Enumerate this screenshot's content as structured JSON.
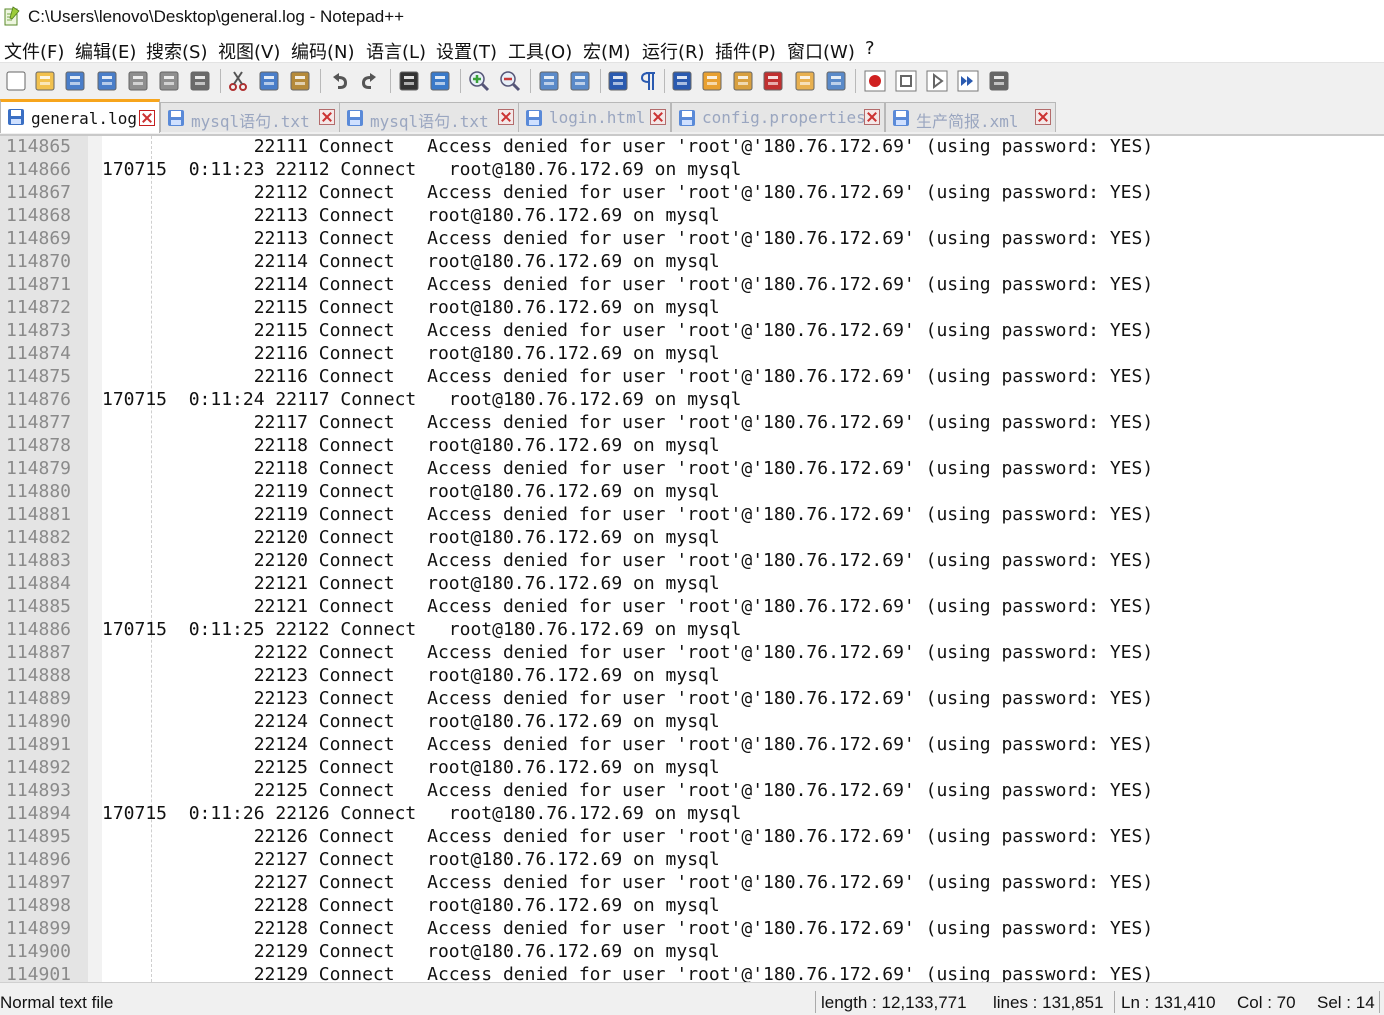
{
  "window": {
    "title": "C:\\Users\\lenovo\\Desktop\\general.log - Notepad++"
  },
  "menu": [
    "文件(F)",
    "编辑(E)",
    "搜索(S)",
    "视图(V)",
    "编码(N)",
    "语言(L)",
    "设置(T)",
    "工具(O)",
    "宏(M)",
    "运行(R)",
    "插件(P)",
    "窗口(W)",
    "?"
  ],
  "toolbar": {
    "icons": [
      "new-file-icon",
      "open-file-icon",
      "save-icon",
      "save-all-icon",
      "close-icon",
      "close-all-icon",
      "print-icon",
      "cut-icon",
      "copy-icon",
      "paste-icon",
      "undo-icon",
      "redo-icon",
      "find-icon",
      "replace-icon",
      "zoom-in-icon",
      "zoom-out-icon",
      "sync-vertical-icon",
      "sync-horizontal-icon",
      "word-wrap-icon",
      "show-all-chars-icon",
      "indent-guide-icon",
      "language-icon",
      "doc-map-icon",
      "function-list-icon",
      "folder-workspace-icon",
      "monitoring-icon",
      "record-macro-icon",
      "stop-record-icon",
      "play-macro-icon",
      "run-macro-multiple-icon",
      "save-macro-icon"
    ]
  },
  "tabs": [
    {
      "label": "general.log",
      "active": true
    },
    {
      "label": "mysql语句.txt",
      "active": false
    },
    {
      "label": "mysql语句.txt",
      "active": false
    },
    {
      "label": "login.html",
      "active": false
    },
    {
      "label": "config.properties",
      "active": false
    },
    {
      "label": "生产简报.xml",
      "active": false
    }
  ],
  "editor": {
    "lines": [
      {
        "num": "114865",
        "text": "              22111 Connect   Access denied for user 'root'@'180.76.172.69' (using password: YES)"
      },
      {
        "num": "114866",
        "text": "170715  0:11:23 22112 Connect   root@180.76.172.69 on mysql"
      },
      {
        "num": "114867",
        "text": "              22112 Connect   Access denied for user 'root'@'180.76.172.69' (using password: YES)"
      },
      {
        "num": "114868",
        "text": "              22113 Connect   root@180.76.172.69 on mysql"
      },
      {
        "num": "114869",
        "text": "              22113 Connect   Access denied for user 'root'@'180.76.172.69' (using password: YES)"
      },
      {
        "num": "114870",
        "text": "              22114 Connect   root@180.76.172.69 on mysql"
      },
      {
        "num": "114871",
        "text": "              22114 Connect   Access denied for user 'root'@'180.76.172.69' (using password: YES)"
      },
      {
        "num": "114872",
        "text": "              22115 Connect   root@180.76.172.69 on mysql"
      },
      {
        "num": "114873",
        "text": "              22115 Connect   Access denied for user 'root'@'180.76.172.69' (using password: YES)"
      },
      {
        "num": "114874",
        "text": "              22116 Connect   root@180.76.172.69 on mysql"
      },
      {
        "num": "114875",
        "text": "              22116 Connect   Access denied for user 'root'@'180.76.172.69' (using password: YES)"
      },
      {
        "num": "114876",
        "text": "170715  0:11:24 22117 Connect   root@180.76.172.69 on mysql"
      },
      {
        "num": "114877",
        "text": "              22117 Connect   Access denied for user 'root'@'180.76.172.69' (using password: YES)"
      },
      {
        "num": "114878",
        "text": "              22118 Connect   root@180.76.172.69 on mysql"
      },
      {
        "num": "114879",
        "text": "              22118 Connect   Access denied for user 'root'@'180.76.172.69' (using password: YES)"
      },
      {
        "num": "114880",
        "text": "              22119 Connect   root@180.76.172.69 on mysql"
      },
      {
        "num": "114881",
        "text": "              22119 Connect   Access denied for user 'root'@'180.76.172.69' (using password: YES)"
      },
      {
        "num": "114882",
        "text": "              22120 Connect   root@180.76.172.69 on mysql"
      },
      {
        "num": "114883",
        "text": "              22120 Connect   Access denied for user 'root'@'180.76.172.69' (using password: YES)"
      },
      {
        "num": "114884",
        "text": "              22121 Connect   root@180.76.172.69 on mysql"
      },
      {
        "num": "114885",
        "text": "              22121 Connect   Access denied for user 'root'@'180.76.172.69' (using password: YES)"
      },
      {
        "num": "114886",
        "text": "170715  0:11:25 22122 Connect   root@180.76.172.69 on mysql"
      },
      {
        "num": "114887",
        "text": "              22122 Connect   Access denied for user 'root'@'180.76.172.69' (using password: YES)"
      },
      {
        "num": "114888",
        "text": "              22123 Connect   root@180.76.172.69 on mysql"
      },
      {
        "num": "114889",
        "text": "              22123 Connect   Access denied for user 'root'@'180.76.172.69' (using password: YES)"
      },
      {
        "num": "114890",
        "text": "              22124 Connect   root@180.76.172.69 on mysql"
      },
      {
        "num": "114891",
        "text": "              22124 Connect   Access denied for user 'root'@'180.76.172.69' (using password: YES)"
      },
      {
        "num": "114892",
        "text": "              22125 Connect   root@180.76.172.69 on mysql"
      },
      {
        "num": "114893",
        "text": "              22125 Connect   Access denied for user 'root'@'180.76.172.69' (using password: YES)"
      },
      {
        "num": "114894",
        "text": "170715  0:11:26 22126 Connect   root@180.76.172.69 on mysql"
      },
      {
        "num": "114895",
        "text": "              22126 Connect   Access denied for user 'root'@'180.76.172.69' (using password: YES)"
      },
      {
        "num": "114896",
        "text": "              22127 Connect   root@180.76.172.69 on mysql"
      },
      {
        "num": "114897",
        "text": "              22127 Connect   Access denied for user 'root'@'180.76.172.69' (using password: YES)"
      },
      {
        "num": "114898",
        "text": "              22128 Connect   root@180.76.172.69 on mysql"
      },
      {
        "num": "114899",
        "text": "              22128 Connect   Access denied for user 'root'@'180.76.172.69' (using password: YES)"
      },
      {
        "num": "114900",
        "text": "              22129 Connect   root@180.76.172.69 on mysql"
      },
      {
        "num": "114901",
        "text": "              22129 Connect   Access denied for user 'root'@'180.76.172.69' (using password: YES)"
      }
    ]
  },
  "status": {
    "file_type": "Normal text file",
    "length": "length : 12,133,771",
    "lines": "lines : 131,851",
    "ln": "Ln : 131,410",
    "col": "Col : 70",
    "sel": "Sel : 14"
  },
  "colors": {
    "active_tab_accent": "#f7a51c",
    "gutter_bg": "#e4e4e4",
    "inactive_tab_text": "#9aa6c0"
  }
}
